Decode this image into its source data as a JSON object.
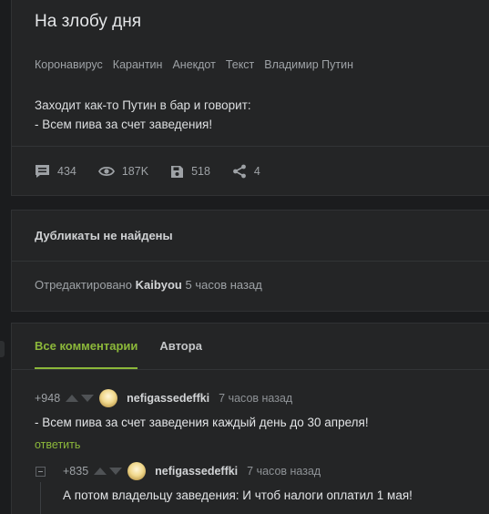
{
  "story": {
    "title": "На злобу дня",
    "tags": [
      "Коронавирус",
      "Карантин",
      "Анекдот",
      "Текст",
      "Владимир Путин"
    ],
    "text_lines": [
      "Заходит как-то Путин в бар и говорит:",
      "- Всем пива за счет заведения!"
    ],
    "stats": {
      "comments": "434",
      "views": "187K",
      "saves": "518",
      "shares": "4"
    },
    "icons": [
      "comment-icon",
      "eye-icon",
      "save-icon",
      "share-icon"
    ]
  },
  "duplicates": {
    "title": "Дубликаты не найдены",
    "edited_prefix": "Отредактировано",
    "edited_user": "Kaibyou",
    "edited_suffix": "5 часов назад"
  },
  "comments": {
    "tabs": [
      "Все комментарии",
      "Автора"
    ],
    "active_tab": "Все комментарии",
    "list": [
      {
        "rating": "+948",
        "author": "nefigassedeffki",
        "time": "7 часов назад",
        "text": "- Всем пива за счет заведения каждый день до 30 апреля!",
        "reply_label": "ответить"
      },
      {
        "rating": "+835",
        "author": "nefigassedeffki",
        "time": "7 часов назад",
        "text": "А потом владельцу заведения: И чтоб налоги оплатил 1 мая!"
      }
    ]
  },
  "colors": {
    "background": "#1b1c1e",
    "card": "#242526",
    "accent": "#8cb83a",
    "muted_text": "#9ea2a6"
  }
}
